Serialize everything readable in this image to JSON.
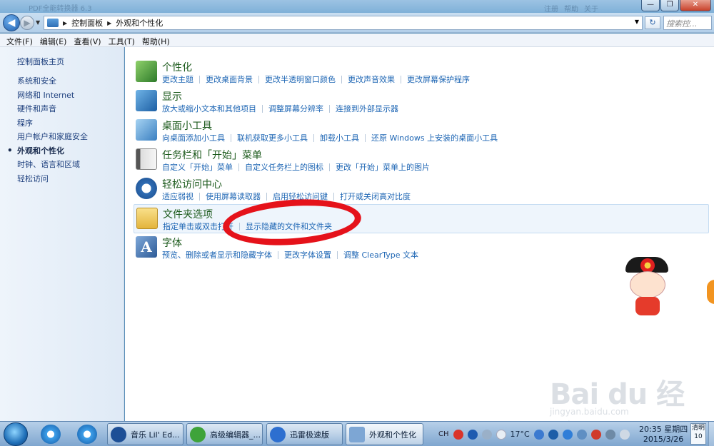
{
  "window": {
    "ghost_title": "PDF全能转换器 6.3",
    "ghost_menu": [
      "注册",
      "帮助",
      "关于"
    ],
    "min": "—",
    "max": "❐",
    "close": "✕"
  },
  "address": {
    "crumbs": [
      "控制面板",
      "外观和个性化"
    ],
    "search_placeholder": "搜索控..."
  },
  "menu": [
    "文件(F)",
    "编辑(E)",
    "查看(V)",
    "工具(T)",
    "帮助(H)"
  ],
  "sidebar": {
    "home": "控制面板主页",
    "items": [
      "系统和安全",
      "网络和 Internet",
      "硬件和声音",
      "程序",
      "用户帐户和家庭安全",
      "外观和个性化",
      "时钟、语言和区域",
      "轻松访问"
    ]
  },
  "categories": [
    {
      "title": "个性化",
      "icon": "personalization-icon",
      "links": [
        "更改主题",
        "更改桌面背景",
        "更改半透明窗口颜色",
        "更改声音效果",
        "更改屏幕保护程序"
      ]
    },
    {
      "title": "显示",
      "icon": "display-icon",
      "links": [
        "放大或缩小文本和其他项目",
        "调整屏幕分辨率",
        "连接到外部显示器"
      ]
    },
    {
      "title": "桌面小工具",
      "icon": "gadgets-icon",
      "links": [
        "向桌面添加小工具",
        "联机获取更多小工具",
        "卸载小工具",
        "还原 Windows 上安装的桌面小工具"
      ]
    },
    {
      "title": "任务栏和「开始」菜单",
      "icon": "taskbar-icon",
      "links": [
        "自定义「开始」菜单",
        "自定义任务栏上的图标",
        "更改「开始」菜单上的图片"
      ]
    },
    {
      "title": "轻松访问中心",
      "icon": "ease-of-access-icon",
      "links": [
        "适应弱视",
        "使用屏幕读取器",
        "启用轻松访问键",
        "打开或关闭高对比度"
      ]
    },
    {
      "title": "文件夹选项",
      "icon": "folder-options-icon",
      "links": [
        "指定单击或双击打开",
        "显示隐藏的文件和文件夹"
      ]
    },
    {
      "title": "字体",
      "icon": "fonts-icon",
      "links": [
        "预览、删除或者显示和隐藏字体",
        "更改字体设置",
        "调整 ClearType 文本"
      ]
    }
  ],
  "watermark": {
    "brand": "Bai du 经验",
    "url": "jingyan.baidu.com"
  },
  "taskbar": {
    "tasks": [
      "音乐 Lil' Ed...",
      "高级编辑器_...",
      "迅雷极速版",
      "外观和个性化"
    ],
    "lang": "CH",
    "weather": "17°C",
    "time": "20:35 星期四",
    "date": "2015/3/26",
    "weather_badge_top": "清明",
    "weather_badge_bottom": "10"
  }
}
